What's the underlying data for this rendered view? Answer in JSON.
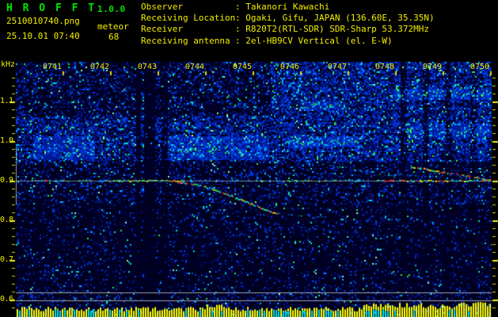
{
  "header": {
    "app_title": "H R O F F T",
    "app_version": "1.0.0",
    "file_name": "2510010740.png",
    "mode": "meteor",
    "timestamp": "25.10.01 07:40",
    "event_count": "68",
    "station": {
      "rows": [
        {
          "label": "Observer",
          "value": "Takanori Kawachi"
        },
        {
          "label": "Receiving Location",
          "value": "Ogaki, Gifu, JAPAN (136.60E, 35.35N)"
        },
        {
          "label": "Receiver",
          "value": "R820T2(RTL-SDR) SDR-Sharp 53.372MHz"
        },
        {
          "label": "Receiving antenna",
          "value": "2el-HB9CV Vertical (el. E-W)"
        }
      ]
    },
    "colors": {
      "title": "#00e400",
      "text": "#f2ee00"
    }
  },
  "chart_data": {
    "type": "heatmap",
    "subtype": "radio-meteor-spectrogram",
    "x_axis": {
      "labels": [
        "0741",
        "0742",
        "0743",
        "0744",
        "0745",
        "0746",
        "0747",
        "0748",
        "0749",
        "0750"
      ],
      "start": "0740",
      "end": "0750",
      "minutes_span": 10
    },
    "y_axis": {
      "unit": "kHz",
      "ticks": [
        {
          "label": "1.1",
          "khz": 1.1
        },
        {
          "label": "1.0",
          "khz": 1.0
        },
        {
          "label": "0.9",
          "khz": 0.9
        },
        {
          "label": "0.8",
          "khz": 0.8
        },
        {
          "label": "0.7",
          "khz": 0.7
        },
        {
          "label": "0.6",
          "khz": 0.6
        }
      ],
      "minor_step_khz": 0.02,
      "top_khz": 1.2,
      "bottom_khz": 0.556
    },
    "carrier": {
      "khz": 0.9,
      "segments": [
        {
          "m": [
            0.33,
            2.05
          ],
          "density": 0.5,
          "palette": [
            "cyan",
            "cyan",
            "green",
            "green",
            "red"
          ]
        },
        {
          "m": [
            2.05,
            3.55
          ],
          "density": 0.95,
          "palette": [
            "green",
            "green",
            "yellow",
            "red",
            "red",
            "cyan"
          ]
        },
        {
          "m": [
            3.55,
            5.15
          ],
          "density": 0.25,
          "palette": [
            "cyan",
            "green"
          ]
        },
        {
          "m": [
            5.15,
            6.9
          ],
          "density": 0.6,
          "palette": [
            "green",
            "cyan",
            "green",
            "yellow"
          ]
        },
        {
          "m": [
            6.9,
            7.6
          ],
          "density": 0.35,
          "palette": [
            "cyan",
            "green"
          ]
        },
        {
          "m": [
            7.6,
            10.0
          ],
          "density": 0.9,
          "palette": [
            "red",
            "red",
            "green",
            "yellow",
            "cyan"
          ]
        }
      ]
    },
    "meteor_echo": {
      "points_min_khz": [
        [
          3.37,
          0.9
        ],
        [
          3.67,
          0.894
        ],
        [
          3.93,
          0.888
        ],
        [
          4.2,
          0.878
        ],
        [
          4.47,
          0.866
        ],
        [
          4.73,
          0.854
        ],
        [
          4.97,
          0.842
        ],
        [
          5.2,
          0.83
        ],
        [
          5.4,
          0.822
        ],
        [
          5.53,
          0.818
        ]
      ],
      "tail_min_khz": [
        [
          5.53,
          0.818
        ],
        [
          5.67,
          0.816
        ],
        [
          6.0,
          0.812
        ],
        [
          6.33,
          0.81
        ],
        [
          6.67,
          0.808
        ]
      ]
    },
    "aircraft_traces": [
      {
        "from": [
          5.5,
          0.962
        ],
        "to": [
          8.0,
          0.91
        ],
        "bright": false
      },
      {
        "from": [
          7.38,
          0.926
        ],
        "to": [
          8.5,
          0.912
        ],
        "bright": false
      },
      {
        "from": [
          8.3,
          0.937
        ],
        "to": [
          10.02,
          0.903
        ],
        "bright": true
      }
    ],
    "wavy_bands": [
      {
        "m": [
          7.95,
          10.0
        ],
        "khz": 1.122
      },
      {
        "m": [
          6.0,
          6.87
        ],
        "khz": 1.09
      },
      {
        "m": [
          8.2,
          10.0
        ],
        "khz": 1.027
      },
      {
        "m": [
          5.72,
          7.2
        ],
        "khz": 0.997
      },
      {
        "m": [
          3.3,
          4.3
        ],
        "khz": 0.975
      }
    ],
    "noise_regions": [
      {
        "m": [
          0,
          10
        ],
        "khz": [
          0.55,
          1.2
        ],
        "level": 0.31
      },
      {
        "m": [
          0,
          10
        ],
        "khz": [
          0.55,
          0.842
        ],
        "level": 0.24
      },
      {
        "m": [
          0,
          10
        ],
        "khz": [
          0.842,
          0.952
        ],
        "level": 0.33
      },
      {
        "m": [
          0,
          5.35
        ],
        "khz": [
          0.952,
          1.065
        ],
        "level": 0.55
      },
      {
        "m": [
          0,
          5.35
        ],
        "khz": [
          1.065,
          1.2
        ],
        "level": 0.37
      },
      {
        "m": [
          5.35,
          10
        ],
        "khz": [
          0.952,
          1.2
        ],
        "level": 0.58
      },
      {
        "m": [
          0,
          10
        ],
        "khz": [
          0.55,
          0.625
        ],
        "level": 0.3
      }
    ],
    "noise_clusters": [
      {
        "m": [
          0.35,
          1.65
        ],
        "khz": [
          0.955,
          1.012
        ],
        "boost": 0.17
      },
      {
        "m": [
          3.2,
          5.3
        ],
        "khz": [
          0.955,
          1.015
        ],
        "boost": 0.17
      },
      {
        "m": [
          5.72,
          7.2
        ],
        "khz": [
          0.985,
          1.012
        ],
        "boost": 0.17
      },
      {
        "m": [
          6.0,
          6.9
        ],
        "khz": [
          1.078,
          1.103
        ],
        "boost": 0.17
      },
      {
        "m": [
          7.9,
          10.0
        ],
        "khz": [
          1.108,
          1.135
        ],
        "boost": 0.17
      },
      {
        "m": [
          8.2,
          10.0
        ],
        "khz": [
          1.012,
          1.045
        ],
        "boost": 0.17
      }
    ],
    "interference_gaps": [
      {
        "m": [
          2.53,
          2.63
        ],
        "factor": 0.18
      },
      {
        "m": [
          2.68,
          2.93
        ],
        "factor": 0.22
      },
      {
        "m": [
          3.05,
          3.18
        ],
        "factor": 0.5
      },
      {
        "m": [
          8.08,
          8.2
        ],
        "factor": 0.6
      },
      {
        "m": [
          8.56,
          8.68
        ],
        "factor": 0.6
      },
      {
        "m": [
          9.02,
          9.14
        ],
        "factor": 0.6
      },
      {
        "m": [
          9.56,
          9.68
        ],
        "factor": 0.65
      }
    ],
    "detection_window": {
      "khz": [
        0.84,
        0.984
      ]
    },
    "meter": {
      "ref_khz": [
        0.618,
        0.598
      ],
      "bar_color": "#ffff00",
      "alt_color": "#00e4e4",
      "profile": [
        {
          "m": [
            0,
            4.0
          ],
          "h": 10
        },
        {
          "m": [
            4.0,
            4.45
          ],
          "h": 13
        },
        {
          "m": [
            4.45,
            7.3
          ],
          "h": 10
        },
        {
          "m": [
            7.3,
            8.6
          ],
          "h": 15
        },
        {
          "m": [
            8.6,
            9.3
          ],
          "h": 13
        },
        {
          "m": [
            9.3,
            10.0
          ],
          "h": 16
        }
      ],
      "cyan_prob": [
        {
          "m": [
            0,
            5.2
          ],
          "p": 0.2
        },
        {
          "m": [
            5.2,
            8.0
          ],
          "p": 0.45
        },
        {
          "m": [
            8.0,
            10
          ],
          "p": 0.08
        }
      ]
    },
    "palette": {
      "red": "#ff3a14",
      "yellow": "#ffd800",
      "green": "#2de25a",
      "cyan": "#00d0ff",
      "blue": "#0040e6",
      "dark_blue": "#001a96",
      "tick": "#ddd51c",
      "gray_line": "#9aa4aa"
    }
  }
}
